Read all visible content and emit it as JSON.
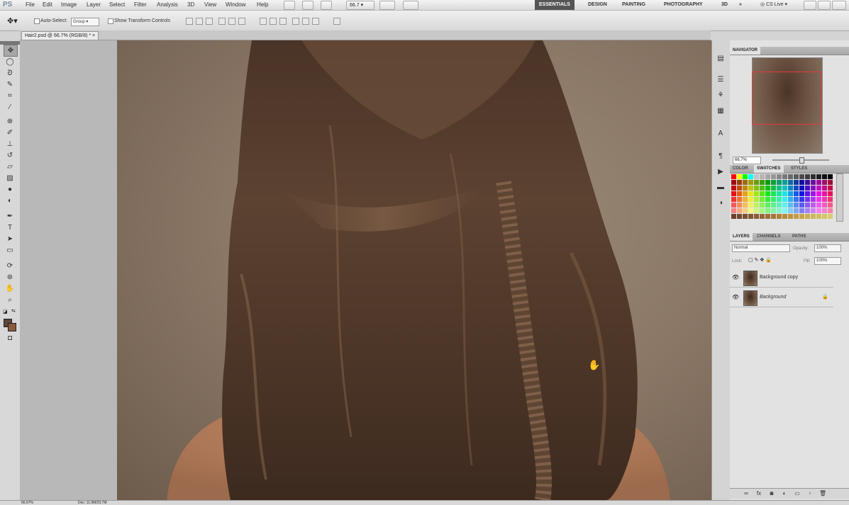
{
  "app": {
    "logo": "PS"
  },
  "menu": [
    "File",
    "Edit",
    "Image",
    "Layer",
    "Select",
    "Filter",
    "Analysis",
    "3D",
    "View",
    "Window",
    "Help"
  ],
  "appbar": {
    "zoom": "66.7"
  },
  "workspaces": [
    "ESSENTIALS",
    "DESIGN",
    "PAINTING",
    "PHOTOGRAPHY",
    "3D"
  ],
  "cslive": "CS Live",
  "options": {
    "auto_select_label": "Auto-Select:",
    "auto_select_value": "Group",
    "show_transform_label": "Show Transform Controls"
  },
  "document": {
    "tab_title": "Hair2.psd @ 66.7% (RGB/8) *"
  },
  "tools": [
    "move-tool",
    "marquee-tool",
    "lasso-tool",
    "quick-select-tool",
    "crop-tool",
    "eyedropper-tool",
    "healing-brush-tool",
    "brush-tool",
    "clone-stamp-tool",
    "history-brush-tool",
    "eraser-tool",
    "gradient-tool",
    "blur-tool",
    "dodge-tool",
    "pen-tool",
    "type-tool",
    "path-select-tool",
    "shape-tool",
    "3d-rotate-tool",
    "3d-orbit-tool",
    "hand-tool",
    "zoom-tool"
  ],
  "colors": {
    "foreground": "#5c4638",
    "background": "#8a5a3c",
    "selection_rect": "#e23b3b",
    "active_workspace": "#555555"
  },
  "navigator": {
    "tab": "NAVIGATOR",
    "zoom": "66.7%"
  },
  "color_panel": {
    "tabs": [
      "COLOR",
      "SWATCHES",
      "STYLES"
    ],
    "active": "SWATCHES"
  },
  "layers_panel": {
    "tabs": [
      "LAYERS",
      "CHANNELS",
      "PATHS"
    ],
    "blend_mode": "Normal",
    "opacity_label": "Opacity:",
    "opacity_value": "100%",
    "lock_label": "Lock:",
    "fill_label": "Fill:",
    "fill_value": "100%",
    "layers": [
      {
        "name": "Background copy",
        "visible": true,
        "locked": false
      },
      {
        "name": "Background",
        "visible": true,
        "locked": true
      }
    ]
  },
  "status": {
    "zoom": "66.67%",
    "doc": "Doc: 11.9M/23.7M"
  }
}
